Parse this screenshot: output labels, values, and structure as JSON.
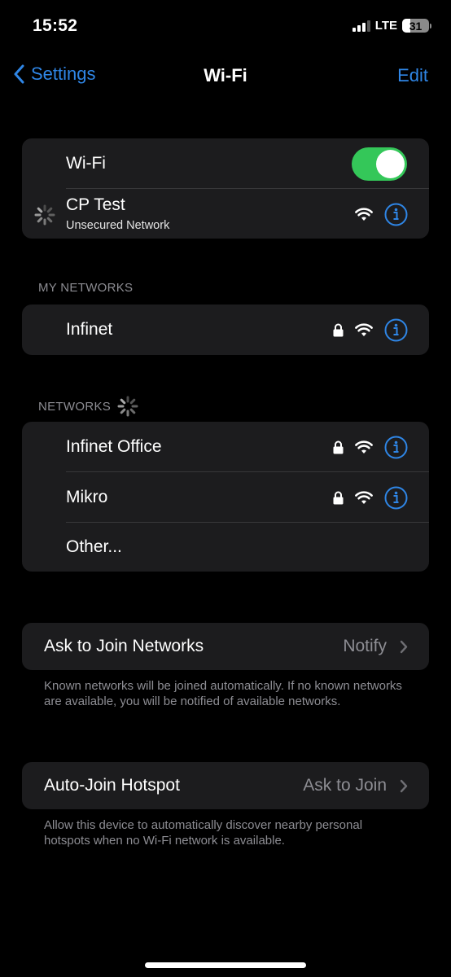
{
  "status_bar": {
    "time": "15:52",
    "network_type": "LTE",
    "battery_level": "31",
    "battery_percent": 31,
    "signal_bars_active": 3,
    "signal_bars_total": 4
  },
  "nav": {
    "back_label": "Settings",
    "title": "Wi-Fi",
    "edit_label": "Edit"
  },
  "wifi_group": {
    "toggle_label": "Wi-Fi",
    "toggle_on": true,
    "current_network": {
      "name": "CP Test",
      "status": "Unsecured Network",
      "connecting": true,
      "secured": false
    }
  },
  "my_networks": {
    "header": "MY NETWORKS",
    "items": [
      {
        "name": "Infinet",
        "secured": true
      }
    ]
  },
  "networks": {
    "header": "NETWORKS",
    "scanning": true,
    "items": [
      {
        "name": "Infinet Office",
        "secured": true
      },
      {
        "name": "Mikro",
        "secured": true
      }
    ],
    "other_label": "Other..."
  },
  "ask_to_join": {
    "label": "Ask to Join Networks",
    "value": "Notify",
    "footer": "Known networks will be joined automatically. If no known networks are available, you will be notified of available networks."
  },
  "auto_join_hotspot": {
    "label": "Auto-Join Hotspot",
    "value": "Ask to Join",
    "footer": "Allow this device to automatically discover nearby personal hotspots when no Wi-Fi network is available."
  },
  "colors": {
    "accent": "#2f86e6",
    "toggle_on": "#34c759",
    "cell_background": "#1c1c1e",
    "secondary_text": "#8d8d93"
  }
}
